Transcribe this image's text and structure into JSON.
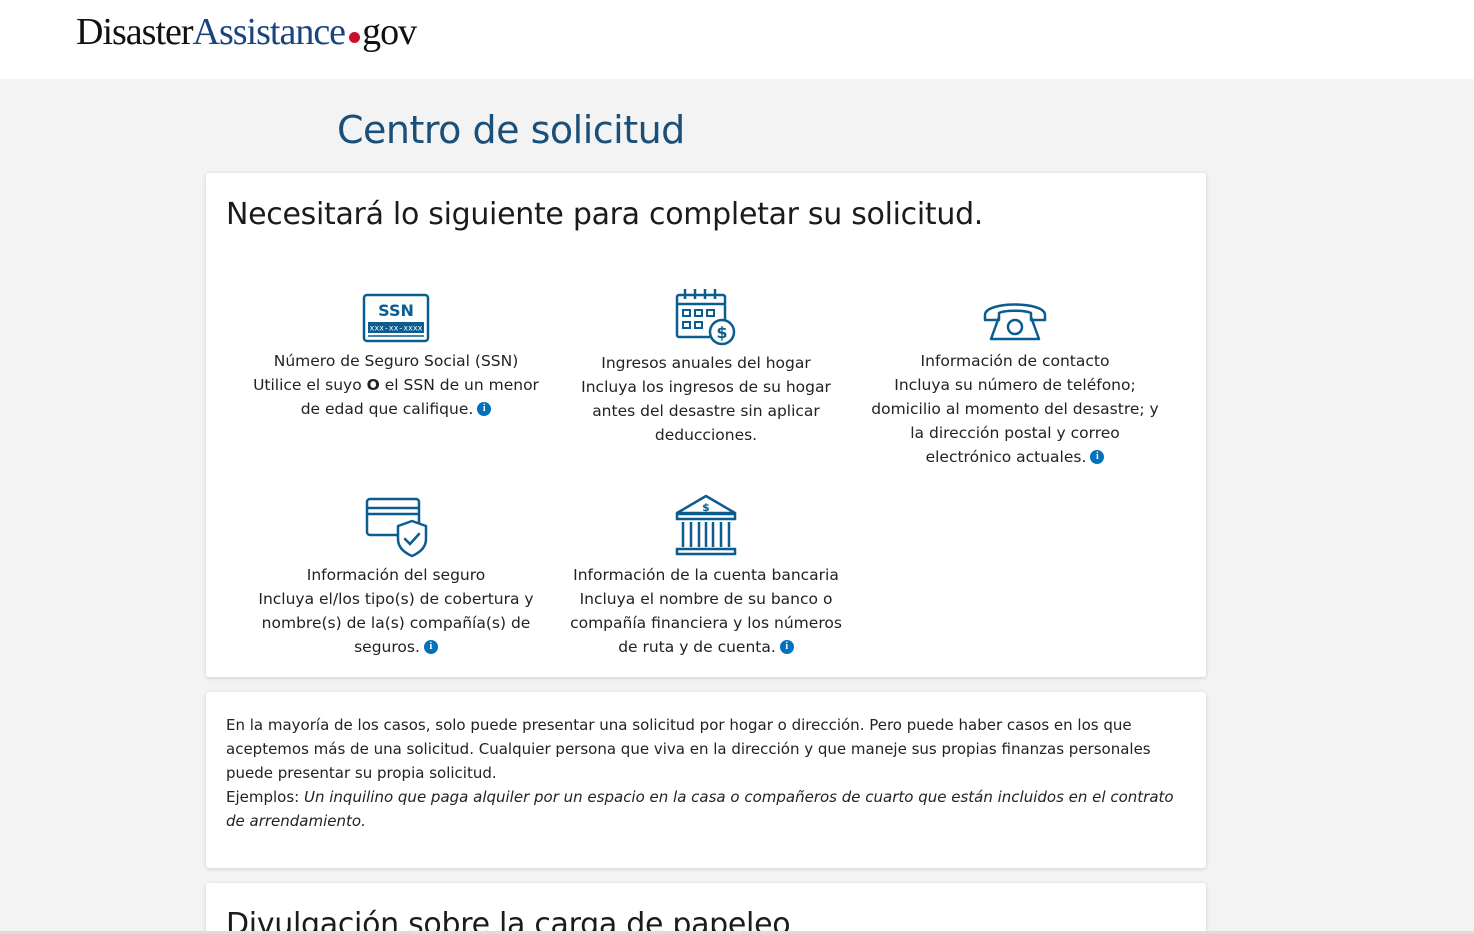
{
  "header": {
    "logo_part1": "Disaster",
    "logo_part2": "Assistance",
    "logo_part3": "gov"
  },
  "page_title": "Centro de solicitud",
  "requirements_card": {
    "heading": "Necesitará lo siguiente para completar su solicitud.",
    "items": [
      {
        "icon": "ssn-card-icon",
        "title": "Número de Seguro Social (SSN)",
        "desc_before": "Utilice el suyo ",
        "desc_bold": "O",
        "desc_after": " el SSN de un menor de edad que califique.",
        "ssn_label": "SSN",
        "ssn_mask": "xxx-xx-xxxx"
      },
      {
        "icon": "calendar-dollar-icon",
        "title": "Ingresos anuales del hogar",
        "desc": "Incluya los ingresos de su hogar antes del desastre sin aplicar deducciones."
      },
      {
        "icon": "telephone-icon",
        "title": "Información de contacto",
        "desc": "Incluya su número de teléfono; domicilio al momento del desastre; y la dirección postal y correo electrónico actuales."
      },
      {
        "icon": "insurance-card-shield-icon",
        "title": "Información del seguro",
        "desc": "Incluya el/los tipo(s) de cobertura y nombre(s) de la(s) compañía(s) de seguros."
      },
      {
        "icon": "bank-icon",
        "title": "Información de la cuenta bancaria",
        "desc": "Incluya el nombre de su banco o compañía financiera y los números de ruta y de cuenta."
      }
    ],
    "info_icon_glyph": "i"
  },
  "household_card": {
    "text": "En la mayoría de los casos, solo puede presentar una solicitud por hogar o dirección. Pero puede haber casos en los que aceptemos más de una solicitud. Cualquier persona que viva en la dirección y que maneje sus propias finanzas personales puede presentar su propia solicitud.",
    "examples_label": "Ejemplos: ",
    "examples_text": "Un inquilino que paga alquiler por un espacio en la casa o compañeros de cuarto que están incluidos en el contrato de arrendamiento."
  },
  "paperwork_card": {
    "heading": "Divulgación sobre la carga de papeleo"
  },
  "colors": {
    "brand_blue": "#1a4480",
    "title_blue": "#1a4f7a",
    "icon_blue": "#0b5c8f",
    "info_blue": "#0071bc",
    "logo_dot_red": "#c8102e"
  }
}
